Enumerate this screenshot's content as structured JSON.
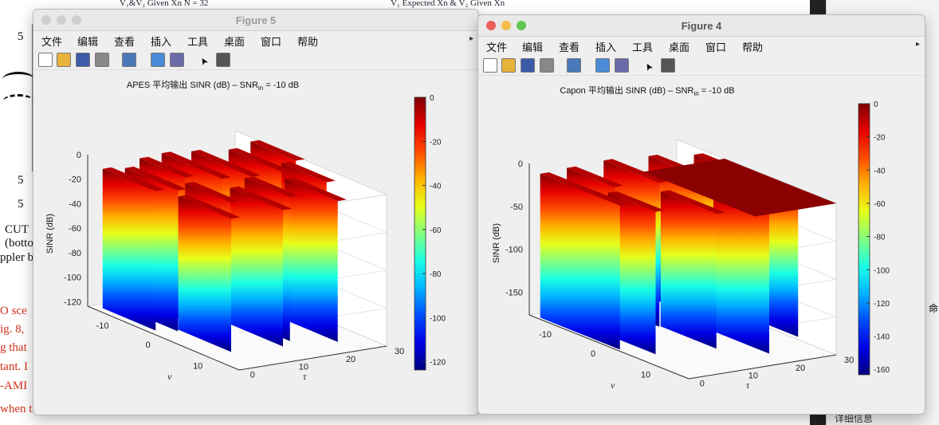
{
  "background": {
    "texts": [
      {
        "t": "CUT",
        "x": 6,
        "y": 280,
        "cls": ""
      },
      {
        "t": "(botto",
        "x": 6,
        "y": 297,
        "cls": ""
      },
      {
        "t": "ppler b",
        "x": 0,
        "y": 315,
        "cls": ""
      },
      {
        "t": "O sce",
        "x": 0,
        "y": 382,
        "cls": "red"
      },
      {
        "t": "ig. 8,",
        "x": 0,
        "y": 405,
        "cls": "red"
      },
      {
        "t": "g that",
        "x": 0,
        "y": 428,
        "cls": "red"
      },
      {
        "t": "tant. I",
        "x": 0,
        "y": 452,
        "cls": "red"
      },
      {
        "t": "-AMI",
        "x": 0,
        "y": 476,
        "cls": "red"
      },
      {
        "t": "when the",
        "x": 0,
        "y": 505,
        "cls": "red"
      },
      {
        "t": "5",
        "x": 22,
        "y": 38,
        "cls": ""
      },
      {
        "t": "5",
        "x": 22,
        "y": 218,
        "cls": ""
      },
      {
        "t": "5",
        "x": 22,
        "y": 248,
        "cls": ""
      }
    ],
    "legend_left": "V₁&V₂ Given Xn N = 32",
    "legend_right": "V₁ Expected Xn & V₂ Given Xn",
    "side_text": "详细信息",
    "side_tab": "命"
  },
  "windows": [
    {
      "id": "fig5",
      "title": "Figure 5",
      "active": false,
      "menu": [
        "文件",
        "编辑",
        "查看",
        "插入",
        "工具",
        "桌面",
        "窗口",
        "帮助"
      ]
    },
    {
      "id": "fig4",
      "title": "Figure 4",
      "active": true,
      "menu": [
        "文件",
        "编辑",
        "查看",
        "插入",
        "工具",
        "桌面",
        "窗口",
        "帮助"
      ]
    }
  ],
  "toolbar_icons": [
    "new-file-icon",
    "open-folder-icon",
    "save-icon",
    "print-icon",
    "print-preview-icon",
    "colorbar-icon",
    "legend-icon",
    "pointer-icon",
    "property-editor-icon"
  ],
  "colors": {
    "close": "#ec5f57",
    "min": "#f5bd4f",
    "max": "#61c554"
  },
  "chart_data": [
    {
      "type": "surface3d",
      "title_main": "APES  平均输出 SINR (dB) – SNR",
      "title_sub": "in",
      "title_tail": " = -10 dB",
      "zlabel": "SINR (dB)",
      "xlabel": "ν",
      "ylabel": "τ",
      "z_ticks": [
        "0",
        "-20",
        "-40",
        "-60",
        "-80",
        "-100",
        "-120"
      ],
      "x_ticks": [
        "-10",
        "0",
        "10"
      ],
      "y_ticks": [
        "0",
        "10",
        "20",
        "30"
      ],
      "colorbar_ticks": [
        "0",
        "-20",
        "-40",
        "-60",
        "-80",
        "-100",
        "-120"
      ],
      "zlim": [
        -125,
        0
      ]
    },
    {
      "type": "surface3d",
      "title_main": "Capon  平均输出 SINR (dB) – SNR",
      "title_sub": "in",
      "title_tail": " = -10 dB",
      "zlabel": "SINR (dB)",
      "xlabel": "ν",
      "ylabel": "τ",
      "z_ticks": [
        "0",
        "-50",
        "-100",
        "-150"
      ],
      "x_ticks": [
        "-10",
        "0",
        "10"
      ],
      "y_ticks": [
        "0",
        "10",
        "20",
        "30"
      ],
      "colorbar_ticks": [
        "0",
        "-20",
        "-40",
        "-60",
        "-80",
        "-100",
        "-120",
        "-140",
        "-160"
      ],
      "zlim": [
        -165,
        0
      ]
    }
  ]
}
